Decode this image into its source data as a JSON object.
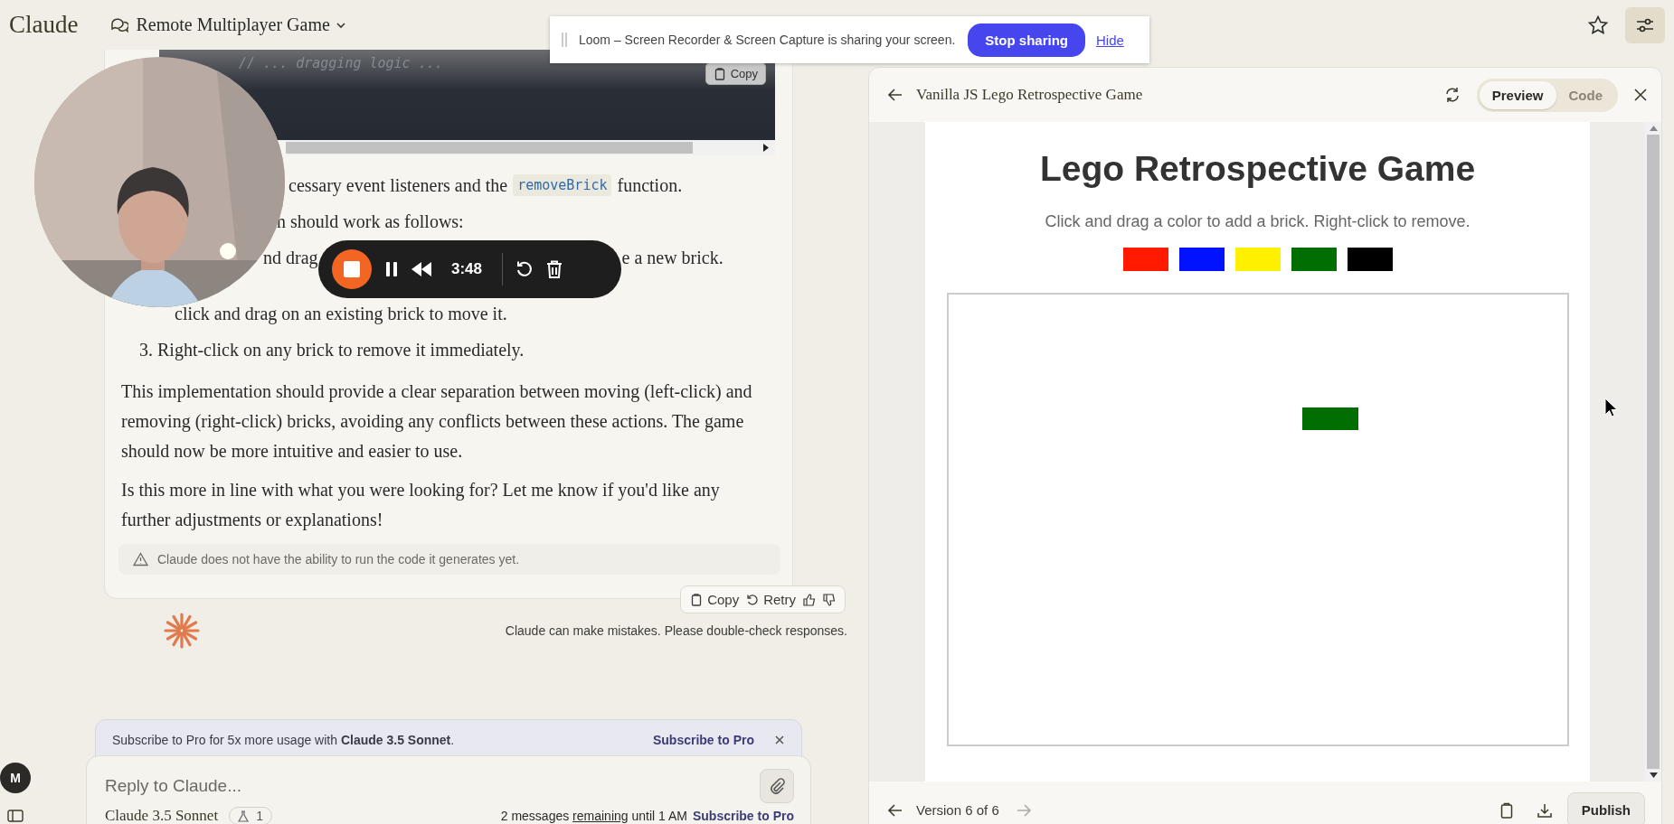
{
  "header": {
    "logo": "Claude",
    "chat_title": "Remote Multiplayer Game"
  },
  "loom_banner": {
    "message": "Loom – Screen Recorder & Screen Capture is sharing your screen.",
    "stop_button": "Stop sharing",
    "hide_link": "Hide"
  },
  "recorder": {
    "time": "3:48"
  },
  "chat": {
    "code_block": {
      "comment": "// ... dragging logic ...",
      "copy_button": "Copy"
    },
    "fragment_lines": [
      {
        "parts": [
          {
            "kind": "text",
            "text": "cessary event listeners and the"
          },
          {
            "kind": "code",
            "text": "removeBrick"
          },
          {
            "kind": "text",
            "text": "function."
          }
        ]
      },
      {
        "parts": [
          {
            "kind": "text",
            "text": "n should work as follows:"
          }
        ]
      },
      {
        "parts": [
          {
            "kind": "text",
            "text": "nd drag"
          },
          {
            "kind": "text",
            "text": "e a new brick."
          }
        ]
      },
      {
        "parts": [
          {
            "kind": "text",
            "text": "click and drag on an existing brick to move it."
          }
        ]
      },
      {
        "parts": [
          {
            "kind": "text",
            "text": "3. Right-click on any brick to remove it immediately."
          }
        ]
      }
    ],
    "paragraphs": [
      "This implementation should provide a clear separation between moving (left-click) and removing (right-click) bricks, avoiding any conflicts between these actions. The game should now be more intuitive and easier to use.",
      "Is this more in line with what you were looking for? Let me know if you'd like any further adjustments or explanations!"
    ],
    "note": "Claude does not have the ability to run the code it generates yet.",
    "actions": [
      "Copy",
      "Retry"
    ],
    "disclaimer": "Claude can make mistakes. Please double-check responses."
  },
  "subscribe_banner": {
    "message": "Subscribe to Pro for 5x more usage with **Claude 3.5 Sonnet**.",
    "link": "Subscribe to Pro"
  },
  "composer": {
    "placeholder": "Reply to Claude...",
    "model": "Claude 3.5 Sonnet",
    "attachment_count": "1",
    "usage_before": "2 messages",
    "usage_link": "remaining",
    "usage_after": "until 1 AM",
    "subscribe_link": "Subscribe to Pro"
  },
  "user_avatar": "M",
  "artifact": {
    "title": "Vanilla JS Lego Retrospective Game",
    "tabs": [
      {
        "label": "Preview",
        "selected": true
      },
      {
        "label": "Code",
        "selected": false
      }
    ],
    "game": {
      "title": "Lego Retrospective Game",
      "instructions": "Click and drag a color to add a brick. Right-click to remove.",
      "swatches": [
        {
          "color": "#ff1a00"
        },
        {
          "color": "#0012ff"
        },
        {
          "color": "#fff000"
        },
        {
          "color": "#006e00"
        },
        {
          "color": "#000000"
        }
      ],
      "bricks": [
        {
          "color": "#006e00"
        }
      ]
    },
    "version": "Version 6 of 6",
    "publish_button": "Publish"
  }
}
